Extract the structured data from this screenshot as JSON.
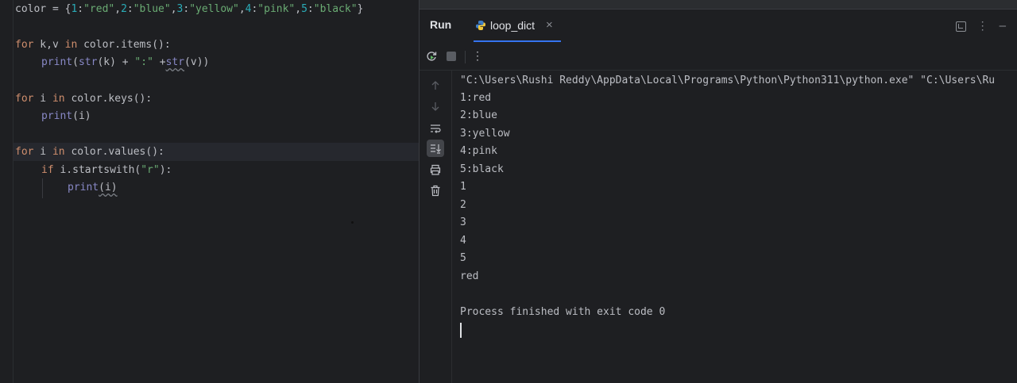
{
  "editor": {
    "lines": {
      "l1": {
        "a": "color = {",
        "n1": "1",
        "s1": "\"red\"",
        "n2": "2",
        "s2": "\"blue\"",
        "n3": "3",
        "s3": "\"yellow\"",
        "n4": "4",
        "s4": "\"pink\"",
        "n5": "5",
        "s5": "\"black\"",
        "end": "}"
      },
      "l2": {
        "kw": "for",
        "mid": " k,v ",
        "kw2": "in",
        "rest": " color.items():"
      },
      "l3": {
        "bi": "print",
        "p1": "(",
        "bi2": "str",
        "p2": "(k) + ",
        "st": "\":\"",
        "p3": " +",
        "bi3": "str",
        "p4": "(v))"
      },
      "l4": {
        "kw": "for",
        "mid": " i ",
        "kw2": "in",
        "rest": " color.keys():"
      },
      "l5": {
        "bi": "print",
        "rest": "(i)"
      },
      "l6": {
        "kw": "for",
        "mid": " i ",
        "kw2": "in",
        "rest": " color.values():"
      },
      "l7": {
        "kw": "if",
        "mid": " i.startswith(",
        "st": "\"r\"",
        "rest": "):"
      },
      "l8": {
        "bi": "print",
        "rest": "(i)"
      }
    }
  },
  "run_panel": {
    "title": "Run",
    "tab_label": "loop_dict",
    "tab_close": "×",
    "menu_glyph": "⋮",
    "top_more": "⋮",
    "top_minimize": "—",
    "console": [
      "\"C:\\Users\\Rushi Reddy\\AppData\\Local\\Programs\\Python\\Python311\\python.exe\" \"C:\\Users\\Ru",
      "1:red",
      "2:blue",
      "3:yellow",
      "4:pink",
      "5:black",
      "1",
      "2",
      "3",
      "4",
      "5",
      "red",
      "",
      "Process finished with exit code 0"
    ]
  },
  "colors": {
    "keyword": "#cf8e6d",
    "builtin": "#8888c6",
    "string": "#6aab73",
    "number": "#2aacb8",
    "accent": "#3574f0"
  }
}
